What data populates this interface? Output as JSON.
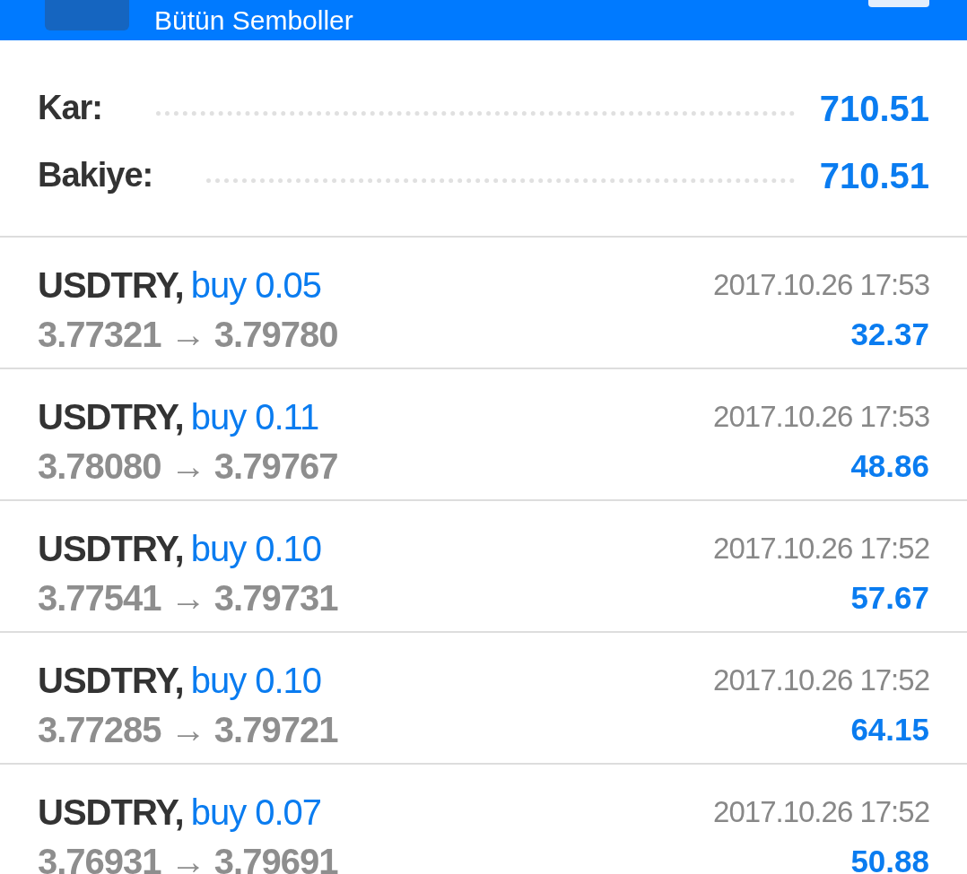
{
  "header": {
    "title": "Bütün Semboller"
  },
  "summary": [
    {
      "label": "Kar:",
      "value": "710.51"
    },
    {
      "label": "Bakiye:",
      "value": "710.51"
    }
  ],
  "trades": [
    {
      "symbol": "USDTRY,",
      "order": "buy 0.05",
      "prices": "3.77321 → 3.79780",
      "time": "2017.10.26 17:53",
      "profit": "32.37"
    },
    {
      "symbol": "USDTRY,",
      "order": "buy 0.11",
      "prices": "3.78080 → 3.79767",
      "time": "2017.10.26 17:53",
      "profit": "48.86"
    },
    {
      "symbol": "USDTRY,",
      "order": "buy 0.10",
      "prices": "3.77541 → 3.79731",
      "time": "2017.10.26 17:52",
      "profit": "57.67"
    },
    {
      "symbol": "USDTRY,",
      "order": "buy 0.10",
      "prices": "3.77285 → 3.79721",
      "time": "2017.10.26 17:52",
      "profit": "64.15"
    },
    {
      "symbol": "USDTRY,",
      "order": "buy 0.07",
      "prices": "3.76931 → 3.79691",
      "time": "2017.10.26 17:52",
      "profit": "50.88"
    }
  ]
}
